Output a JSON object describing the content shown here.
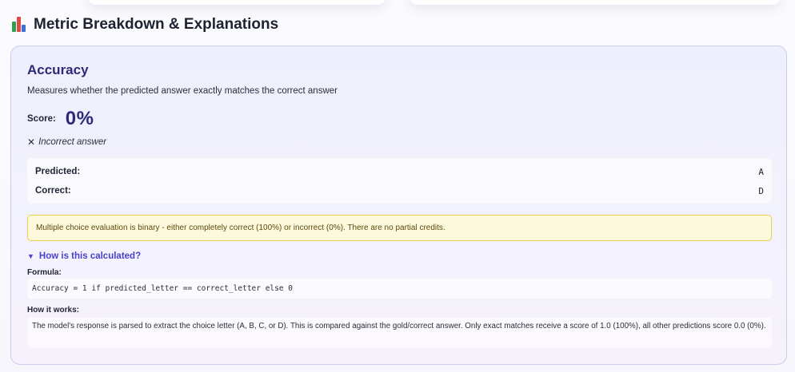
{
  "section": {
    "title": "Metric Breakdown & Explanations",
    "icon": "bar-chart-icon"
  },
  "metric": {
    "title": "Accuracy",
    "description": "Measures whether the predicted answer exactly matches the correct answer",
    "score_label": "Score:",
    "score_value": "0%",
    "result_icon": "✕",
    "result_text": "Incorrect answer",
    "predicted_label": "Predicted:",
    "predicted_value": "A",
    "correct_label": "Correct:",
    "correct_value": "D",
    "note": "Multiple choice evaluation is binary - either completely correct (100%) or incorrect (0%). There are no partial credits.",
    "toggle_icon": "▼",
    "toggle_label": "How is this calculated?",
    "formula_label": "Formula:",
    "formula": "Accuracy = 1 if predicted_letter == correct_letter else 0",
    "how_label": "How it works:",
    "how_text": "The model's response is parsed to extract the choice letter (A, B, C, or D). This is compared against the gold/correct answer. Only exact matches receive a score of 1.0 (100%), all other predictions score 0.0 (0%)."
  },
  "colors": {
    "accent": "#2d2a7a",
    "link": "#4a3fcf",
    "note_bg": "#fdf9dc",
    "note_border": "#e9cf4c"
  }
}
